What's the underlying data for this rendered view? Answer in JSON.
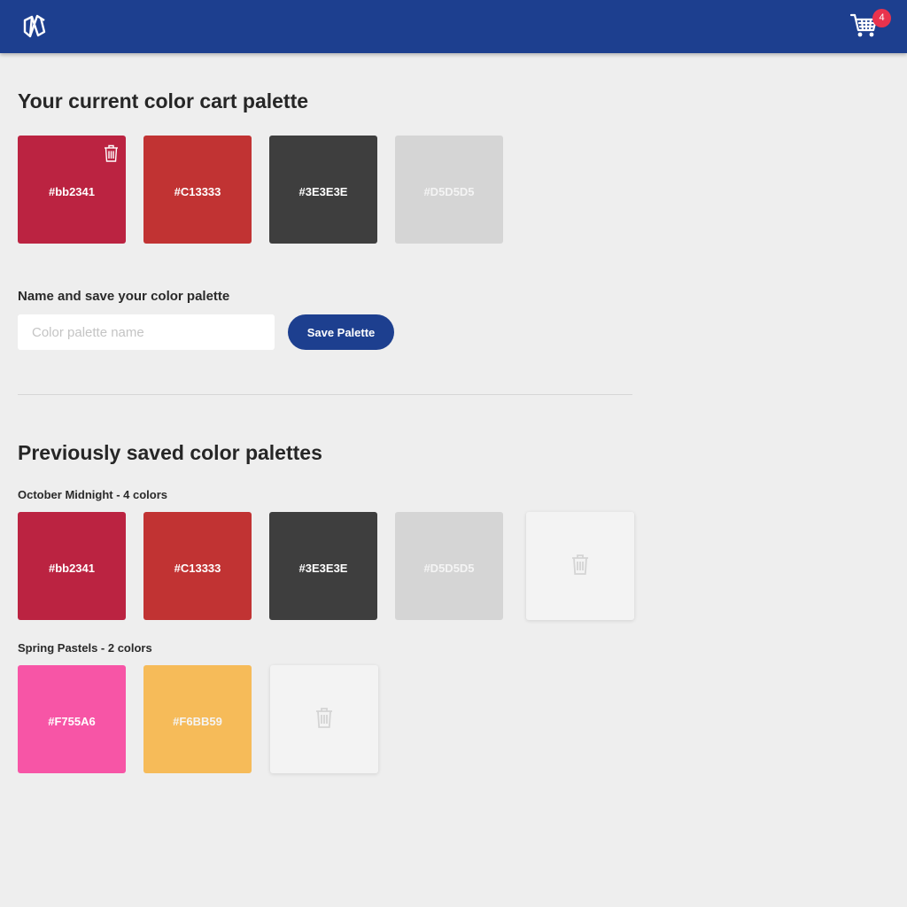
{
  "header": {
    "cart_count": "4",
    "logo_icon": "logo-icon",
    "cart_icon": "cart-icon"
  },
  "current": {
    "heading": "Your current color cart palette",
    "swatches": [
      {
        "hex": "#bb2341",
        "color": "#bb2341"
      },
      {
        "hex": "#C13333",
        "color": "#c13333"
      },
      {
        "hex": "#3E3E3E",
        "color": "#3e3e3e"
      },
      {
        "hex": "#D5D5D5",
        "color": "#d5d5d5"
      }
    ]
  },
  "save": {
    "label": "Name and save your color palette",
    "placeholder": "Color palette name",
    "button": "Save Palette"
  },
  "saved": {
    "heading": "Previously saved color palettes",
    "palettes": [
      {
        "title": "October Midnight - 4 colors",
        "swatches": [
          {
            "hex": "#bb2341",
            "color": "#bb2341"
          },
          {
            "hex": "#C13333",
            "color": "#c13333"
          },
          {
            "hex": "#3E3E3E",
            "color": "#3e3e3e"
          },
          {
            "hex": "#D5D5D5",
            "color": "#d5d5d5"
          }
        ]
      },
      {
        "title": "Spring Pastels - 2 colors",
        "swatches": [
          {
            "hex": "#F755A6",
            "color": "#f755a6"
          },
          {
            "hex": "#F6BB59",
            "color": "#f6bb59"
          }
        ]
      }
    ]
  },
  "colors": {
    "brand": "#1d3f8f",
    "badge": "#e8334d",
    "background": "#eeeeee"
  }
}
